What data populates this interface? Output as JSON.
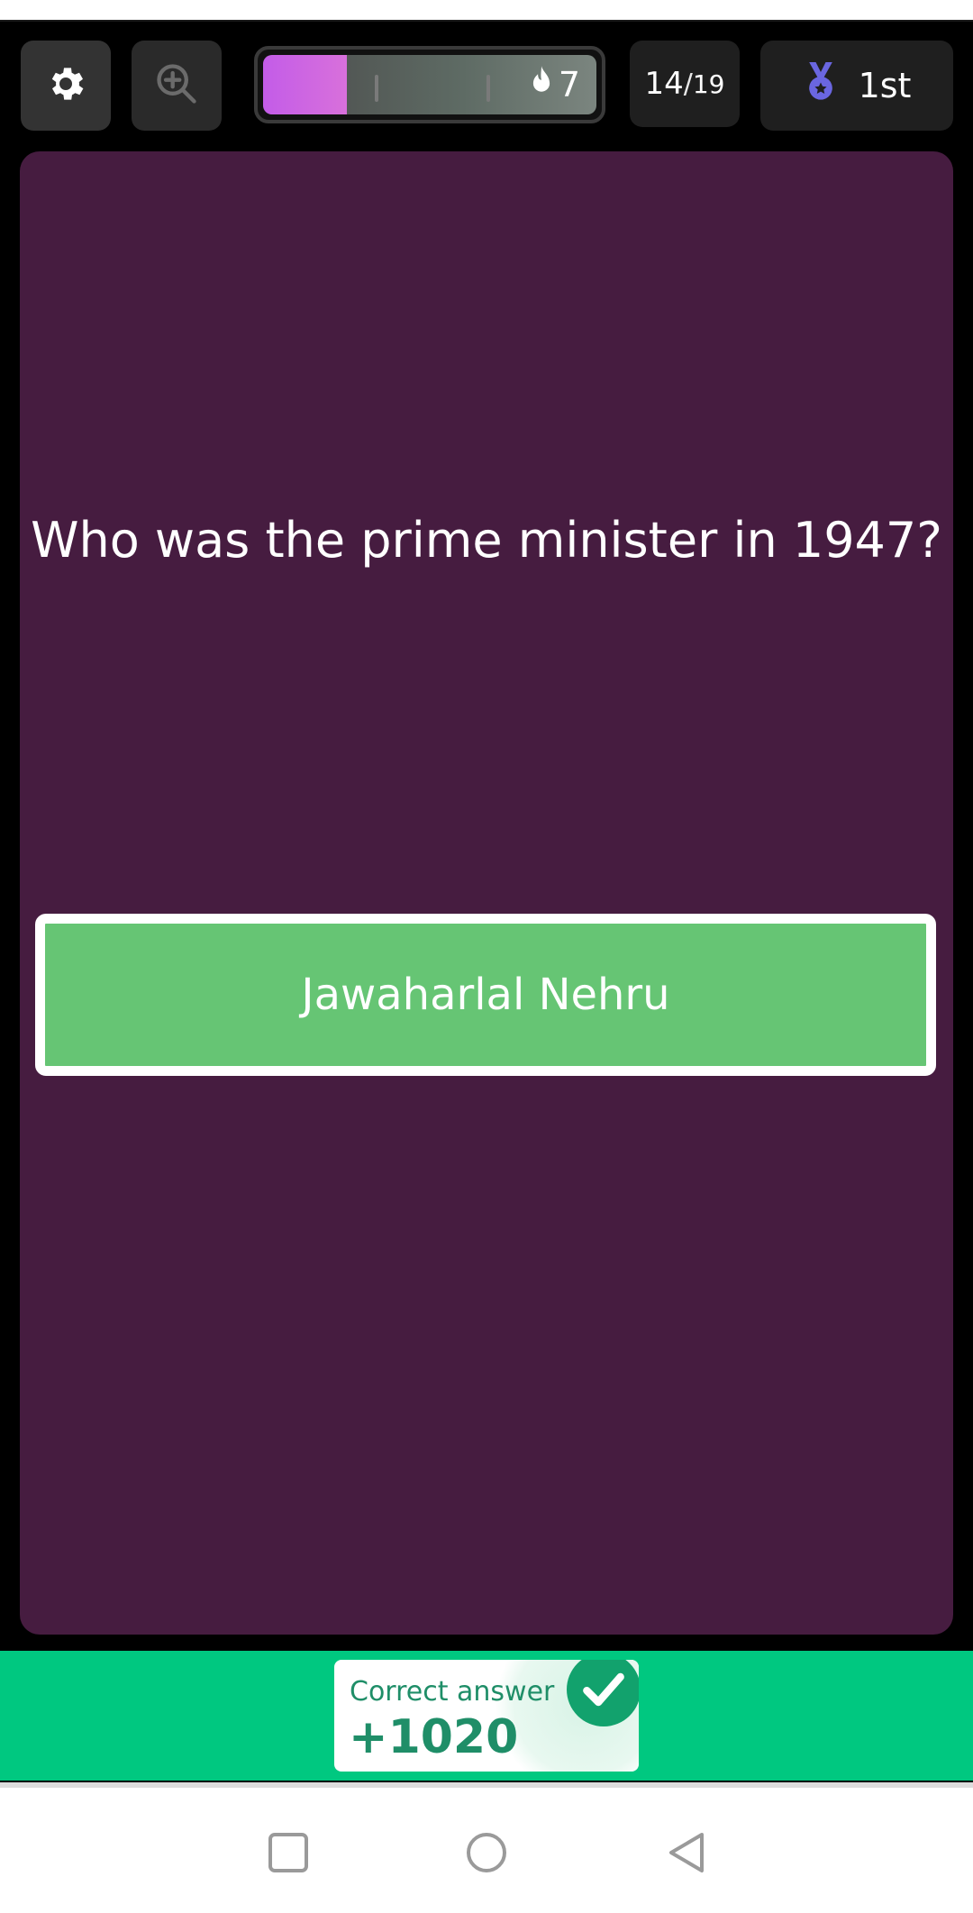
{
  "header": {
    "settings_icon": "gear-icon",
    "zoom_icon": "zoom-in-icon",
    "progress": {
      "fraction": 0.25,
      "streak_icon": "flame-icon",
      "streak_value": "7",
      "fill_color": "#c35ce8"
    },
    "question_counter": {
      "current": "14",
      "separator": "/",
      "total": "19"
    },
    "rank": {
      "icon": "medal-icon",
      "value": "1st"
    }
  },
  "question": {
    "text": "Who was the prime minister in 1947?"
  },
  "answer": {
    "text": "Jawaharlal Nehru",
    "color": "#66c574"
  },
  "result": {
    "label": "Correct answer",
    "points": "+1020",
    "icon": "check-icon",
    "color": "#00c880"
  },
  "nav": {
    "recent_icon": "square-icon",
    "home_icon": "circle-icon",
    "back_icon": "triangle-back-icon"
  },
  "colors": {
    "card_background": "#461c40",
    "background": "#000000"
  }
}
